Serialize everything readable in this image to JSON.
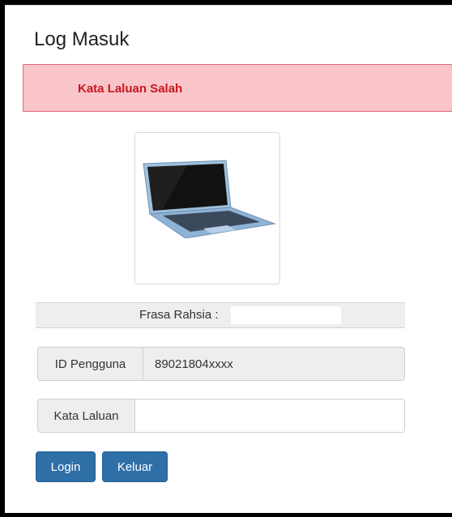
{
  "header": {
    "title": "Log Masuk"
  },
  "alert": {
    "message": "Kata Laluan Salah"
  },
  "image": {
    "icon": "laptop-image"
  },
  "frasa": {
    "label": "Frasa Rahsia :",
    "value": ""
  },
  "user_id": {
    "label": "ID Pengguna",
    "value": "89021804xxxx"
  },
  "password": {
    "label": "Kata Laluan",
    "value": "",
    "placeholder": ""
  },
  "buttons": {
    "login_label": "Login",
    "exit_label": "Keluar"
  },
  "colors": {
    "alert_bg": "#f9c5ca",
    "alert_text": "#c8161d",
    "button_primary": "#2f6fa8"
  }
}
